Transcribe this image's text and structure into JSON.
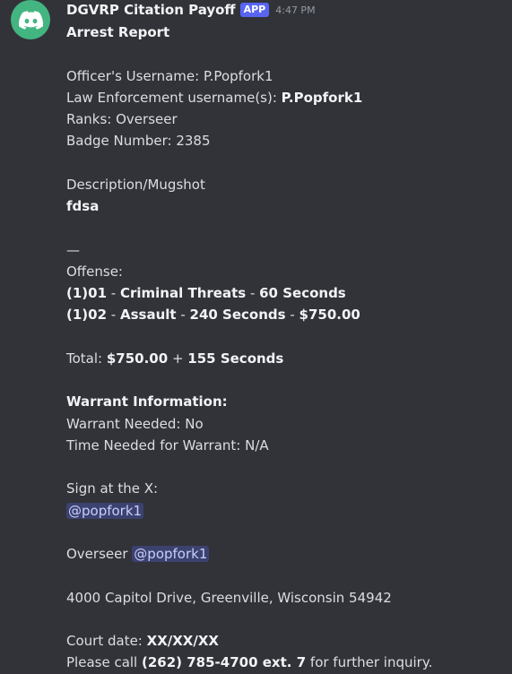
{
  "bot": {
    "name": "DGVRP Citation Payoff",
    "badge": "APP",
    "time": "4:47 PM",
    "avatar_icon": "discord-logo-icon",
    "avatar_color": "#43b581"
  },
  "report": {
    "title": "Arrest Report",
    "officer_label": "Officer's Username: ",
    "officer_value": "P.Popfork1",
    "le_label": "Law Enforcement username(s): ",
    "le_value": "P.Popfork1",
    "ranks_label": "Ranks: ",
    "ranks_value": "Overseer",
    "badge_label": "Badge Number: ",
    "badge_value": "2385",
    "description_label": "Description/Mugshot",
    "description_value": "fdsa",
    "dash": "—",
    "offense_label": "Offense:",
    "offense_1_code": "(1)01",
    "offense_1_sep1": " - ",
    "offense_1_name": "Criminal Threats",
    "offense_1_sep2": " - ",
    "offense_1_time": "60 Seconds",
    "offense_2_code": "(1)02",
    "offense_2_sep1": " - ",
    "offense_2_name": "Assault",
    "offense_2_sep2": " - ",
    "offense_2_time": "240 Seconds",
    "offense_2_sep3": " - ",
    "offense_2_fine": "$750.00",
    "total_label": "Total: ",
    "total_fine": "$750.00",
    "total_plus": " + ",
    "total_time": "155 Seconds",
    "warrant_heading": "Warrant Information:",
    "warrant_needed": "Warrant Needed: No",
    "warrant_time": "Time Needed for Warrant: N/A",
    "sign_label": "Sign at the X:",
    "sign_mention": "@popfork1",
    "overseer_label": "Overseer ",
    "overseer_mention": "@popfork1",
    "address": "4000 Capitol Drive, Greenville, Wisconsin 54942",
    "court_label": "Court date: ",
    "court_value": "XX/XX/XX",
    "call_prefix": "Please call ",
    "call_phone": "(262) 785-4700 ext. 7",
    "call_suffix": " for further inquiry."
  }
}
